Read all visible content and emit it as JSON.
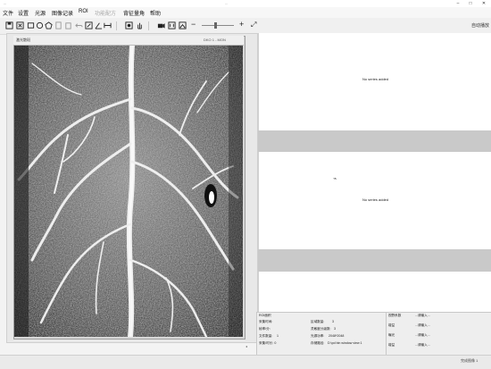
{
  "window": {
    "app_title": "...",
    "doc_title": "...",
    "minimize_glyph": "–",
    "maximize_glyph": "□",
    "close_glyph": "✕"
  },
  "menu": [
    {
      "label": "文件",
      "enabled": true
    },
    {
      "label": "设置",
      "enabled": true
    },
    {
      "label": "光源",
      "enabled": true
    },
    {
      "label": "图像记录",
      "enabled": true
    },
    {
      "label": "ROI",
      "enabled": true
    },
    {
      "label": "功能配方",
      "enabled": false
    },
    {
      "label": "背征量角",
      "enabled": true
    },
    {
      "label": "帮助",
      "enabled": true
    }
  ],
  "toolbar": {
    "icons": [
      "save-icon",
      "export-icon",
      "rectangle-roi-icon",
      "circle-roi-icon",
      "polygon-roi-icon",
      "copy-icon",
      "paste-icon",
      "undo-icon",
      "edit-icon",
      "angle-icon",
      "measure-icon",
      "settings-icon",
      "pan-icon",
      "snapshot-icon",
      "record-icon",
      "image-icon",
      "fit-icon"
    ],
    "zoom_out": "−",
    "zoom_in": "+",
    "fullscreen": "⤢",
    "right_button": "自动播放"
  },
  "viewer": {
    "label": "激光散斑",
    "readout": "DKO 1 - MON"
  },
  "series": [
    {
      "title": "No series added"
    },
    {
      "title": "No series added"
    }
  ],
  "info_left": [
    {
      "label": "ROI面积",
      "value": ""
    },
    {
      "label": "采集时间:",
      "value": ""
    },
    {
      "label": "帧率/分:",
      "value": ""
    },
    {
      "label": "文件数量:",
      "value": "1"
    },
    {
      "label": "采集/时长: 0",
      "value": ""
    },
    {
      "label": "区域数量:",
      "value": "3"
    },
    {
      "label": "灵敏度分级数:",
      "value": "3"
    },
    {
      "label": "光源功率:",
      "value": "2048*2048"
    },
    {
      "label": "存储路径:",
      "value": "D:\\pd bin window view 1"
    }
  ],
  "info_right": [
    {
      "label": "视野系数",
      "value": "...请输入..."
    },
    {
      "label": "增益",
      "value": "...请输入..."
    },
    {
      "label": "曝光",
      "value": "...请输入..."
    },
    {
      "label": "增益",
      "value": "...请输入..."
    }
  ],
  "status": {
    "text": "完成图像 1"
  },
  "colors": {
    "accent": "#1e6fcf",
    "band": "#c9c9c9"
  }
}
